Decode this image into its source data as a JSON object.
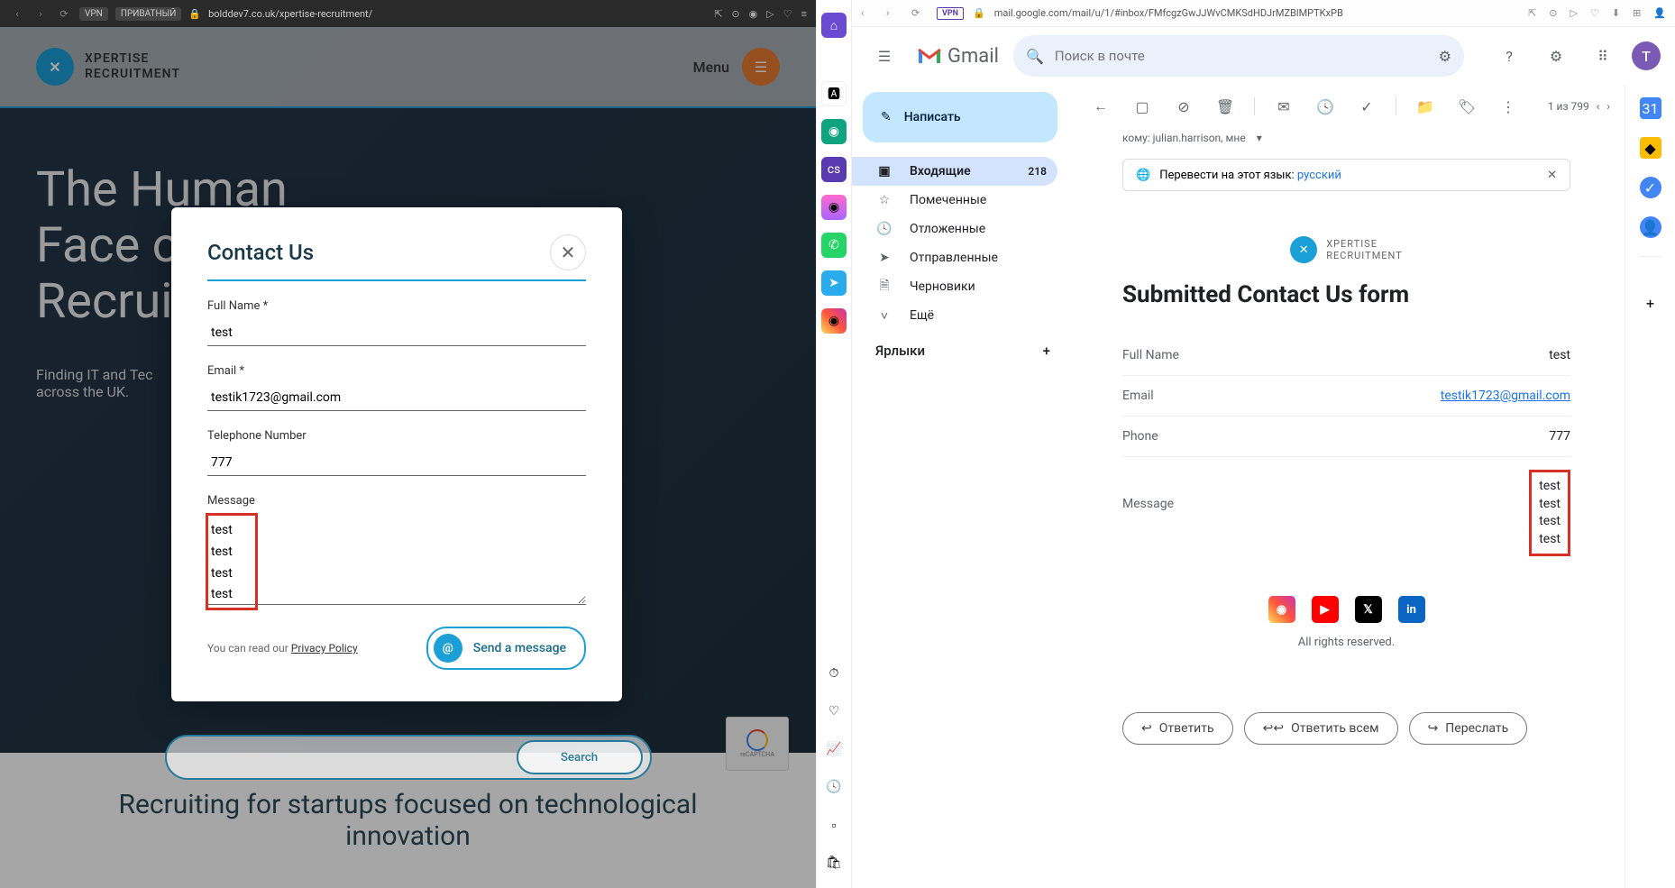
{
  "left_browser": {
    "vpn_badge": "VPN",
    "private_badge": "ПРИВАТНЫЙ",
    "url": "bolddev7.co.uk/xpertise-recruitment/"
  },
  "site": {
    "logo_line1": "XPERTISE",
    "logo_line2": "RECRUITMENT",
    "menu_label": "Menu",
    "hero_title": "The Human\nFace of\nRecruit",
    "hero_sub": "Finding IT and Tec\nacross the UK.",
    "search_button": "Search",
    "below_heading": "Recruiting for startups focused on technological innovation"
  },
  "modal": {
    "title": "Contact Us",
    "full_name_label": "Full Name *",
    "full_name_value": "test",
    "email_label": "Email *",
    "email_value": "testik1723@gmail.com",
    "phone_label": "Telephone Number",
    "phone_value": "777",
    "message_label": "Message",
    "message_value": "test\ntest\ntest\ntest",
    "privacy_prefix": "You can read our ",
    "privacy_link": "Privacy Policy",
    "send_label": "Send a message"
  },
  "right_browser": {
    "vpn_badge": "VPN",
    "url": "mail.google.com/mail/u/1/#inbox/FMfcgzGwJJWvCMKSdHDJrMZBlMPTKxPB"
  },
  "gmail": {
    "logo_text": "Gmail",
    "search_placeholder": "Поиск в почте",
    "avatar_letter": "T",
    "compose_label": "Написать",
    "nav": [
      {
        "icon": "inbox",
        "label": "Входящие",
        "count": "218",
        "active": true
      },
      {
        "icon": "star",
        "label": "Помеченные"
      },
      {
        "icon": "clock",
        "label": "Отложенные"
      },
      {
        "icon": "send",
        "label": "Отправленные"
      },
      {
        "icon": "file",
        "label": "Черновики"
      },
      {
        "icon": "chevron",
        "label": "Ещё"
      }
    ],
    "labels_header": "Ярлыки",
    "pager": "1 из 799",
    "sender_line": "кому: julian.harrison, мне",
    "translate_prefix": "Перевести на этот язык: ",
    "translate_lang": "русский"
  },
  "email": {
    "logo_line1": "XPERTISE",
    "logo_line2": "RECRUITMENT",
    "title": "Submitted Contact Us form",
    "rows": {
      "full_name_label": "Full Name",
      "full_name_value": "test",
      "email_label": "Email",
      "email_value": "testik1723@gmail.com",
      "phone_label": "Phone",
      "phone_value": "777",
      "message_label": "Message",
      "message_lines": [
        "test",
        "test",
        "test",
        "test"
      ]
    },
    "rights": "All rights reserved.",
    "reply": "Ответить",
    "reply_all": "Ответить всем",
    "forward": "Переслать"
  }
}
